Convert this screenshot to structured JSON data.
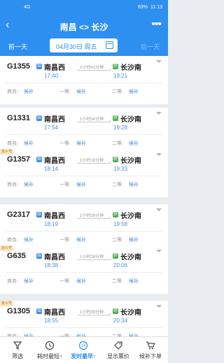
{
  "status_bar": {
    "signal": "4G",
    "battery": "83%",
    "time": "11:13"
  },
  "header": {
    "title": "南昌 <> 长沙",
    "back_icon": "back-icon",
    "more_icon": "more-icon"
  },
  "date_bar": {
    "prev_label": "前一天",
    "date_label": "04月30日 周五",
    "next_label": "后一天"
  },
  "trains": [
    {
      "no": "G1355",
      "fuxing": "",
      "from": "南昌西",
      "to": "长沙南",
      "dep": "17:40",
      "arr": "19:21",
      "duration": "1小时41分钟",
      "seats": [
        {
          "name": "商务:",
          "status": "候补"
        },
        {
          "name": "一等:",
          "status": "候补"
        },
        {
          "name": "二等:",
          "status": "候补"
        }
      ]
    },
    {
      "no": "G1331",
      "fuxing": "",
      "from": "南昌西",
      "to": "长沙南",
      "dep": "17:54",
      "arr": "19:28",
      "duration": "1小时34分钟",
      "seats": [
        {
          "name": "商务:",
          "status": "候补"
        },
        {
          "name": "一等:",
          "status": "候补"
        },
        {
          "name": "二等:",
          "status": "候补"
        }
      ]
    },
    {
      "no": "G1357",
      "fuxing": "复兴号",
      "from": "南昌西",
      "to": "长沙南",
      "dep": "18:14",
      "arr": "19:33",
      "duration": "1小时19分钟",
      "seats": [
        {
          "name": "商务:",
          "status": "候补"
        },
        {
          "name": "一等:",
          "status": "候补"
        },
        {
          "name": "二等:",
          "status": "候补"
        }
      ]
    },
    {
      "no": "G2317",
      "fuxing": "",
      "from": "南昌西",
      "to": "长沙南",
      "dep": "18:19",
      "arr": "19:58",
      "duration": "1小时39分钟",
      "seats": [
        {
          "name": "商务:",
          "status": "候补"
        },
        {
          "name": "一等:",
          "status": "候补"
        },
        {
          "name": "二等:",
          "status": "候补"
        }
      ]
    },
    {
      "no": "G635",
      "fuxing": "复兴号",
      "from": "南昌西",
      "to": "长沙南",
      "dep": "18:38",
      "arr": "20:06",
      "duration": "1小时28分钟",
      "seats": [
        {
          "name": "商务:",
          "status": "候补"
        },
        {
          "name": "一等:",
          "status": "候补"
        },
        {
          "name": "二等:",
          "status": "候补"
        }
      ]
    },
    {
      "no": "G1305",
      "fuxing": "复兴号",
      "from": "南昌西",
      "to": "长沙南",
      "dep": "18:55",
      "arr": "20:34",
      "duration": "1小时39分钟",
      "seats": [
        {
          "name": "商务:",
          "status": "候补"
        },
        {
          "name": "一等:",
          "status": "候补"
        },
        {
          "name": "二等:",
          "status": "候补"
        }
      ]
    }
  ],
  "tabs": [
    {
      "label": "筛选",
      "icon": "filter-icon"
    },
    {
      "label": "耗时最短↑",
      "icon": "clock-icon"
    },
    {
      "label": "发时最早↑",
      "icon": "calendar-icon",
      "active": true
    },
    {
      "label": "显示票价",
      "icon": "price-tag-icon"
    },
    {
      "label": "候补下单",
      "icon": "cart-icon"
    }
  ],
  "colors": {
    "accent": "#2d8ff0",
    "time": "#4a90e2",
    "start_badge": "#3a8ee6",
    "end_badge": "#4caf50"
  }
}
